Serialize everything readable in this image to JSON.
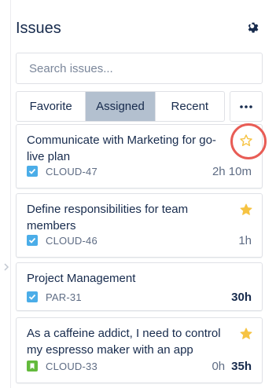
{
  "header": {
    "title": "Issues"
  },
  "search": {
    "placeholder": "Search issues..."
  },
  "tabs": [
    {
      "label": "Favorite",
      "active": false
    },
    {
      "label": "Assigned",
      "active": true
    },
    {
      "label": "Recent",
      "active": false
    }
  ],
  "more_label": "•••",
  "issues": [
    {
      "title": "Communicate with Marketing for go-live plan",
      "key": "CLOUD-47",
      "time": "2h 10m",
      "time_bold": false,
      "starred": false,
      "type": "task",
      "highlighted": true
    },
    {
      "title": "Define responsibilities for team members",
      "key": "CLOUD-46",
      "time": "1h",
      "time_bold": false,
      "starred": true,
      "type": "task"
    },
    {
      "title": "Project Management",
      "key": "PAR-31",
      "time": "30h",
      "time_bold": true,
      "starred": false,
      "type": "task"
    },
    {
      "title": "As a caffeine addict, I need to control my espresso maker with an app",
      "key": "CLOUD-33",
      "time_logged": "0h",
      "time": "35h",
      "time_bold": true,
      "starred": true,
      "type": "story"
    }
  ],
  "colors": {
    "star": "#f6c342",
    "task": "#4bade8",
    "story": "#63ba3c",
    "highlight": "#e85c55",
    "active_tab": "#b3c0cf"
  }
}
